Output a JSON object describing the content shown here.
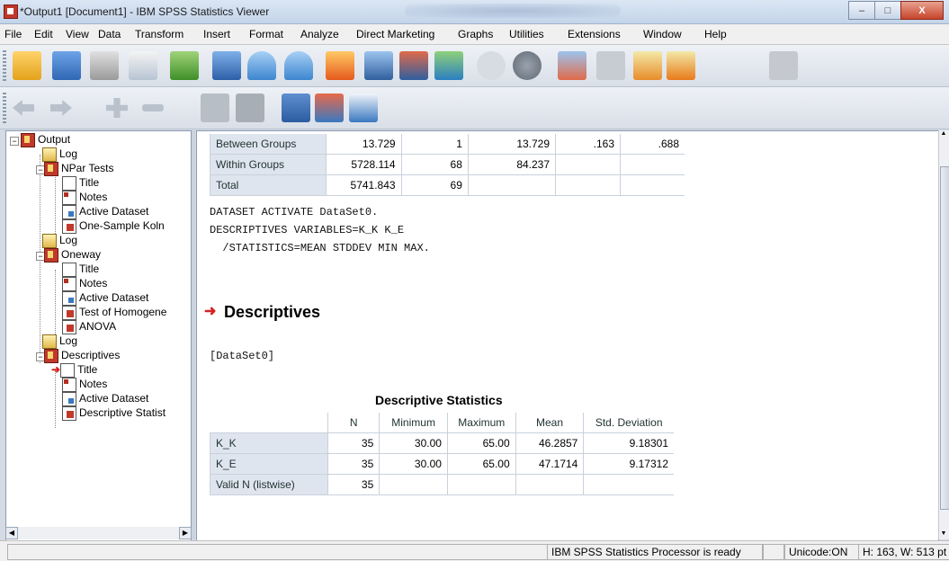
{
  "window": {
    "title": "*Output1 [Document1] - IBM SPSS Statistics Viewer",
    "minimize": "–",
    "maximize": "□",
    "close": "X"
  },
  "menu": [
    "File",
    "Edit",
    "View",
    "Data",
    "Transform",
    "Insert",
    "Format",
    "Analyze",
    "Direct Marketing",
    "Graphs",
    "Utilities",
    "Extensions",
    "Window",
    "Help"
  ],
  "outline": {
    "items": [
      {
        "label": "Output",
        "icon": "book-icon"
      },
      {
        "label": "Log",
        "icon": "log-icon"
      },
      {
        "label": "NPar Tests",
        "icon": "book-icon"
      },
      {
        "label": "Title",
        "icon": "title-icon"
      },
      {
        "label": "Notes",
        "icon": "notes-icon"
      },
      {
        "label": "Active Dataset",
        "icon": "dataset-icon"
      },
      {
        "label": "One-Sample Koln",
        "icon": "table-icon"
      },
      {
        "label": "Log",
        "icon": "log-icon"
      },
      {
        "label": "Oneway",
        "icon": "book-icon"
      },
      {
        "label": "Title",
        "icon": "title-icon"
      },
      {
        "label": "Notes",
        "icon": "notes-icon"
      },
      {
        "label": "Active Dataset",
        "icon": "dataset-icon"
      },
      {
        "label": "Test of Homogene",
        "icon": "table-icon"
      },
      {
        "label": "ANOVA",
        "icon": "table-icon"
      },
      {
        "label": "Log",
        "icon": "log-icon"
      },
      {
        "label": "Descriptives",
        "icon": "book-icon"
      },
      {
        "label": "Title",
        "icon": "title-icon"
      },
      {
        "label": "Notes",
        "icon": "notes-icon"
      },
      {
        "label": "Active Dataset",
        "icon": "dataset-icon"
      },
      {
        "label": "Descriptive Statist",
        "icon": "table-icon"
      }
    ]
  },
  "anova": {
    "rows": [
      [
        "Between Groups",
        "13.729",
        "1",
        "13.729",
        ".163",
        ".688"
      ],
      [
        "Within Groups",
        "5728.114",
        "68",
        "84.237",
        "",
        ""
      ],
      [
        "Total",
        "5741.843",
        "69",
        "",
        "",
        ""
      ]
    ]
  },
  "syntax": {
    "line1": "DATASET ACTIVATE DataSet0.",
    "line2": "DESCRIPTIVES VARIABLES=K_K K_E",
    "line3": "  /STATISTICS=MEAN STDDEV MIN MAX."
  },
  "descriptives": {
    "heading": "Descriptives",
    "dataset": "[DataSet0]",
    "table_title": "Descriptive Statistics",
    "headers": [
      "N",
      "Minimum",
      "Maximum",
      "Mean",
      "Std. Deviation"
    ],
    "rows": [
      [
        "K_K",
        "35",
        "30.00",
        "65.00",
        "46.2857",
        "9.18301"
      ],
      [
        "K_E",
        "35",
        "30.00",
        "65.00",
        "47.1714",
        "9.17312"
      ],
      [
        "Valid N (listwise)",
        "35",
        "",
        "",
        "",
        ""
      ]
    ]
  },
  "status": {
    "processor": "IBM SPSS Statistics Processor is ready",
    "unicode": "Unicode:ON",
    "dims": "H: 163, W: 513 pt"
  }
}
